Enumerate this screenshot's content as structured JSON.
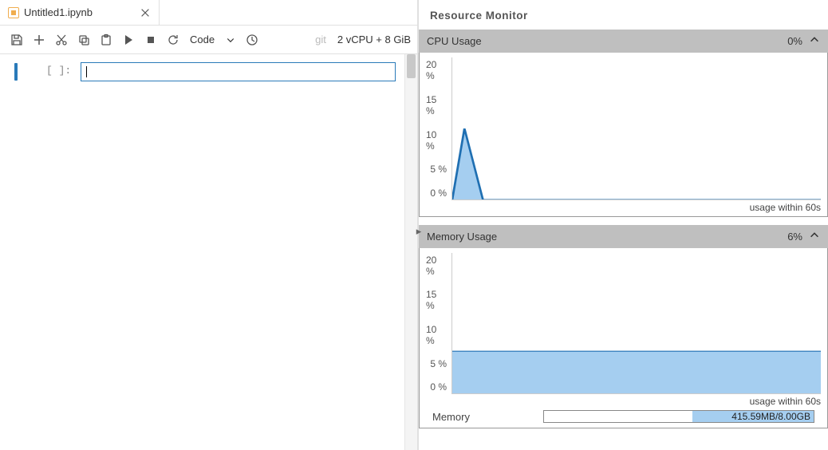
{
  "tab": {
    "title": "Untitled1.ipynb"
  },
  "toolbar": {
    "cell_type": "Code",
    "git": "git",
    "resources": "2 vCPU + 8 GiB"
  },
  "cell": {
    "prompt": "[  ]:"
  },
  "monitor": {
    "title": "Resource Monitor",
    "footer_label": "usage within 60s",
    "cpu": {
      "title": "CPU Usage",
      "value": "0%"
    },
    "memory": {
      "title": "Memory Usage",
      "value": "6%",
      "label": "Memory",
      "bar_text": "415.59MB/8.00GB",
      "bar_fill_pct": 45
    },
    "yticks": [
      "20 %",
      "15 %",
      "10 %",
      "5 %",
      "0 %"
    ]
  },
  "chart_data": [
    {
      "type": "area",
      "title": "CPU Usage",
      "ylabel": "%",
      "ylim": [
        0,
        20
      ],
      "x": [
        0,
        2,
        5,
        60
      ],
      "series": [
        {
          "name": "cpu",
          "values": [
            0,
            10,
            0,
            0
          ]
        }
      ],
      "footer": "usage within 60s"
    },
    {
      "type": "area",
      "title": "Memory Usage",
      "ylabel": "%",
      "ylim": [
        0,
        20
      ],
      "x": [
        0,
        60
      ],
      "series": [
        {
          "name": "memory",
          "values": [
            6,
            6
          ]
        }
      ],
      "footer": "usage within 60s"
    }
  ]
}
